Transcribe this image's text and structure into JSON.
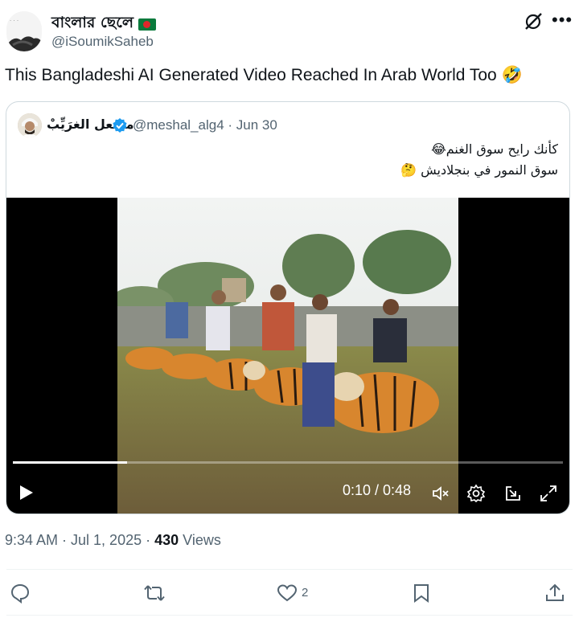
{
  "author": {
    "display_name": "বাংলার ছেলে",
    "handle": "@iSoumikSaheb",
    "flag_icon": "bangladesh-flag-icon"
  },
  "tweet": {
    "text": "This Bangladeshi AI Generated Video Reached In Arab World Too 🤣"
  },
  "quote": {
    "display_name": "مشعل الغرَيِّبْ",
    "handle_date": "@meshal_alg4 · Jun 30",
    "line1": "كأنك رايح سوق الغنم😂",
    "line2": "سوق النمور في بنجلاديش 🤔"
  },
  "video": {
    "time_display": "0:10 / 0:48",
    "progress": 0.208,
    "description": ""
  },
  "meta": {
    "time_date": "9:34 AM · Jul 1, 2025 · ",
    "views_count": "430",
    "views_label": " Views"
  },
  "actions": {
    "likes": "2"
  },
  "colors": {
    "text": "#0f1419",
    "secondary": "#536471",
    "verified": "#1d9bf0",
    "border": "#cfd9de"
  }
}
